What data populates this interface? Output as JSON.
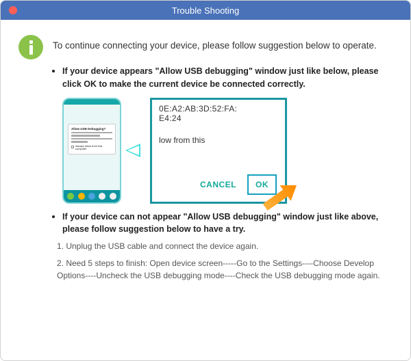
{
  "window": {
    "title": "Trouble Shooting"
  },
  "intro": "To continue connecting your device, please follow suggestion below to operate.",
  "point1": {
    "title": "If your device appears \"Allow USB debugging\" window just like below, please click OK to make the current device  be connected correctly."
  },
  "phoneDialog": {
    "title": "Allow USB Debugging?",
    "checkbox": "Always allow from this computer"
  },
  "bigDialog": {
    "addrLine1": "0E:A2:AB:3D:52:FA:",
    "addrLine2": "E4:24",
    "sub": "low from this",
    "cancel": "CANCEL",
    "ok": "OK"
  },
  "point2": {
    "title": "If your device can not appear \"Allow USB debugging\" window just like above, please follow suggestion below to have a try.",
    "step1": "1. Unplug the USB cable and connect the device again.",
    "step2": "2. Need 5 steps to finish: Open device screen-----Go to the Settings----Choose Develop Options----Uncheck the USB debugging mode----Check the USB debugging mode again."
  }
}
